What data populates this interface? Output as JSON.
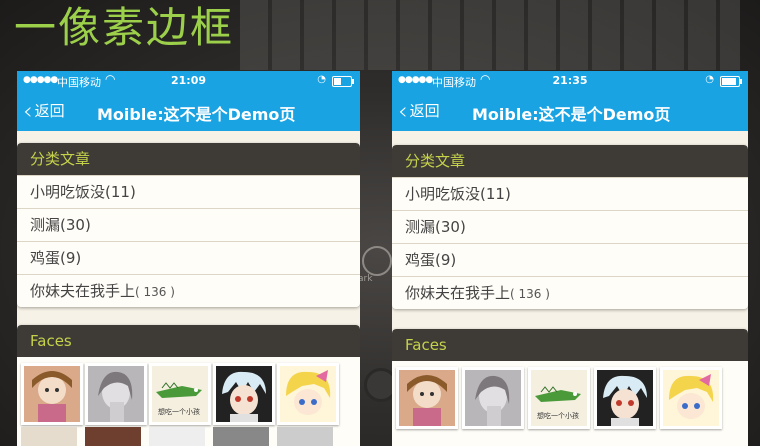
{
  "slide_title": "一像素边框",
  "phones": [
    {
      "status": {
        "carrier": "中国移动",
        "time": "21:09"
      },
      "nav": {
        "back_label": "返回",
        "title": "Moible:这不是个Demo页"
      },
      "category_card": {
        "header": "分类文章",
        "items": [
          {
            "label": "小明吃饭没",
            "count": "(11)"
          },
          {
            "label": "测漏",
            "count": "(30)"
          },
          {
            "label": "鸡蛋",
            "count": "(9)"
          },
          {
            "label": "你妹夫在我手上",
            "count": "( 136 )"
          }
        ]
      },
      "faces_card": {
        "header": "Faces",
        "faces": [
          "avatar-1",
          "avatar-2",
          "avatar-3",
          "avatar-4",
          "avatar-5"
        ]
      }
    },
    {
      "status": {
        "carrier": "中国移动",
        "time": "21:35"
      },
      "nav": {
        "back_label": "返回",
        "title": "Moible:这不是个Demo页"
      },
      "category_card": {
        "header": "分类文章",
        "items": [
          {
            "label": "小明吃饭没",
            "count": "(11)"
          },
          {
            "label": "测漏",
            "count": "(30)"
          },
          {
            "label": "鸡蛋",
            "count": "(9)"
          },
          {
            "label": "你妹夫在我手上",
            "count": "( 136 )"
          }
        ]
      },
      "faces_card": {
        "header": "Faces",
        "faces": [
          "avatar-1",
          "avatar-2",
          "avatar-3",
          "avatar-4",
          "avatar-5"
        ]
      }
    }
  ],
  "face_caption": "想吃一个小孩",
  "background_text": "ark",
  "colors": {
    "accent_blue": "#1aa3e2",
    "title_green": "#9cd04a",
    "card_header_bg": "#3e3b36",
    "card_header_text": "#c5d24a"
  }
}
